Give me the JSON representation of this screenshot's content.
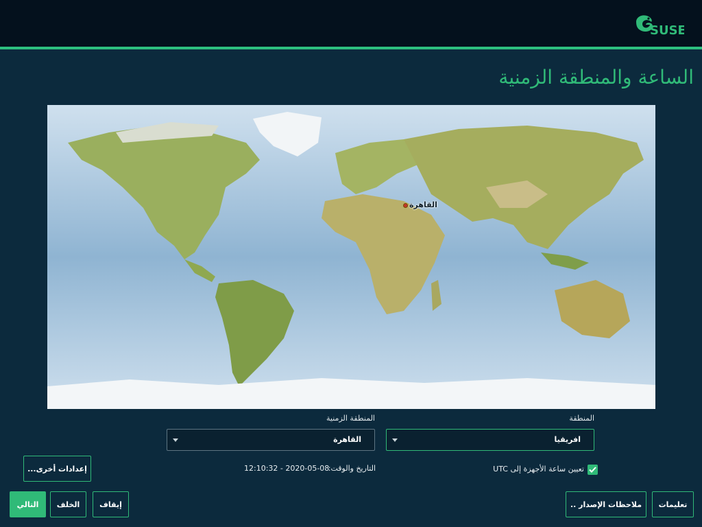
{
  "header": {
    "brand": "SUSE"
  },
  "page": {
    "title": "الساعة والمنطقة الزمنية"
  },
  "map": {
    "selected_city": "القاهرة"
  },
  "region": {
    "label": "المنطقة",
    "value": "افريقيا"
  },
  "timezone": {
    "label": "المنطقة الزمنية",
    "value": "القاهرة"
  },
  "utc": {
    "label": "تعيين ساعة الأجهزة إلى UTC",
    "checked": true
  },
  "datetime": {
    "label": "التاريخ والوقت:",
    "value": "12:10:32 - 2020-05-08"
  },
  "buttons": {
    "other_settings": "إعدادات أخرى...",
    "help": "تعليمات",
    "release_notes": "ملاحظات الإصدار ..",
    "abort": "إيقاف",
    "back": "الخلف",
    "next": "التالي"
  },
  "colors": {
    "accent": "#30ba78",
    "background": "#0c2a3d",
    "topbar": "#04111d"
  }
}
